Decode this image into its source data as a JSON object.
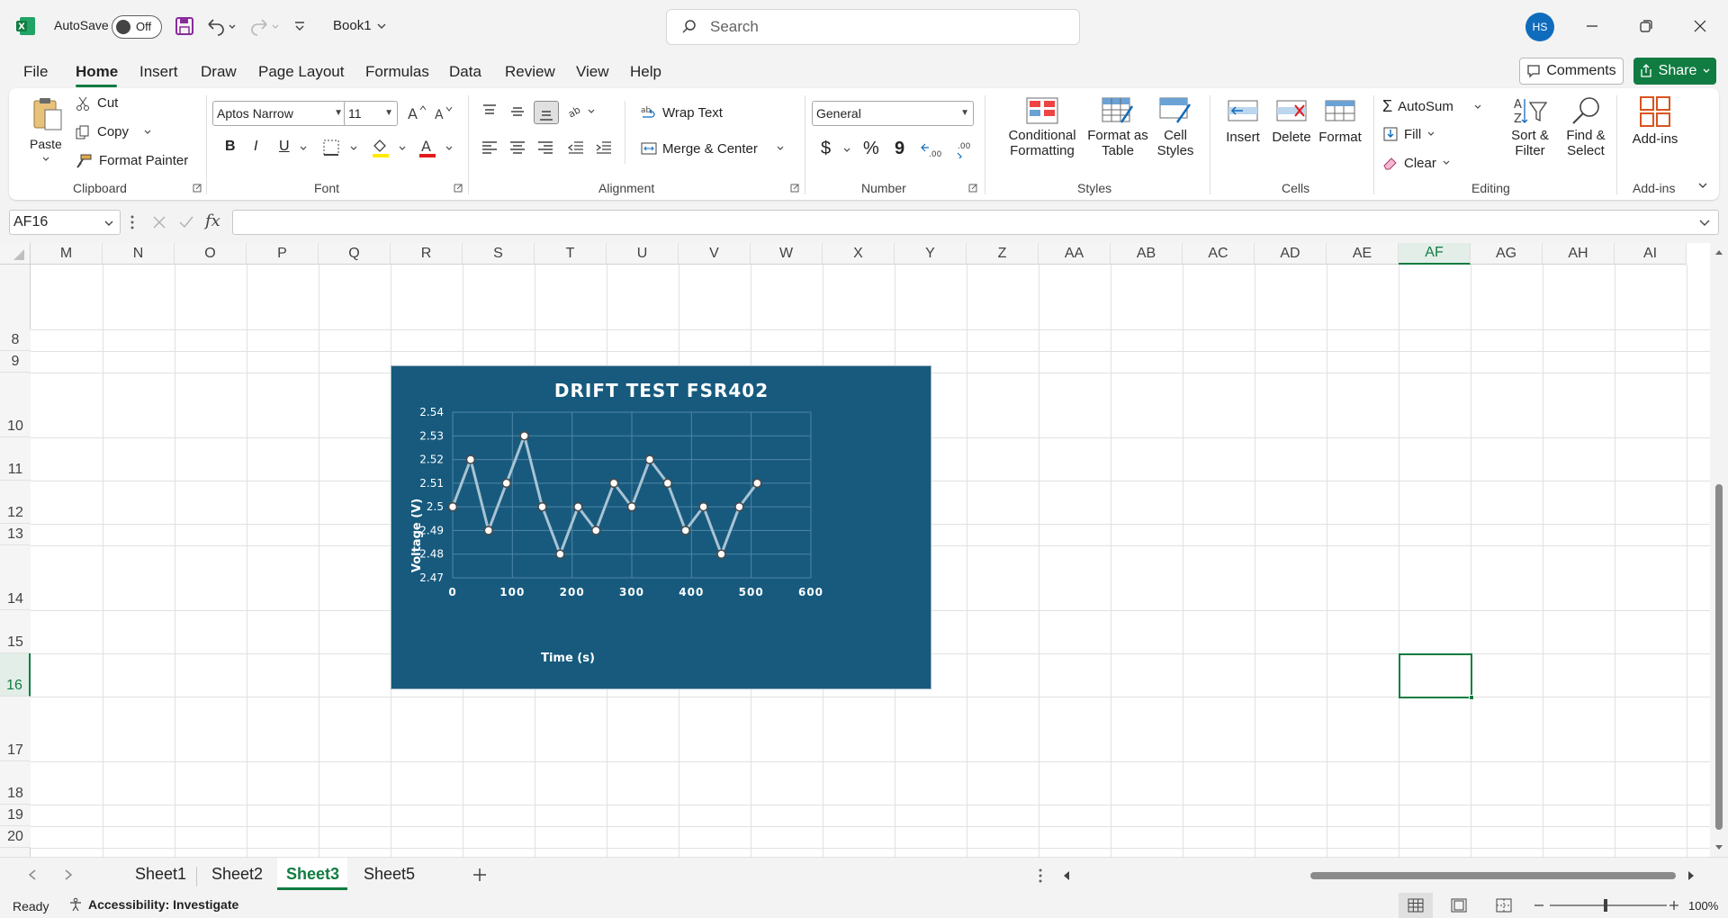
{
  "titlebar": {
    "app_icon": "excel-icon",
    "autosave_label": "AutoSave",
    "autosave_state": "Off",
    "workbook_name": "Book1",
    "search_placeholder": "Search",
    "user_initials": "HS"
  },
  "menu": {
    "items": [
      "File",
      "Home",
      "Insert",
      "Draw",
      "Page Layout",
      "Formulas",
      "Data",
      "Review",
      "View",
      "Help"
    ],
    "active": "Home",
    "comments_label": "Comments",
    "share_label": "Share"
  },
  "ribbon": {
    "clipboard": {
      "paste": "Paste",
      "cut": "Cut",
      "copy": "Copy",
      "format_painter": "Format Painter",
      "group": "Clipboard"
    },
    "font": {
      "name": "Aptos Narrow",
      "size": "11",
      "bold": "B",
      "italic": "I",
      "underline": "U",
      "group": "Font"
    },
    "alignment": {
      "wrap_text": "Wrap Text",
      "merge_center": "Merge & Center",
      "group": "Alignment"
    },
    "number": {
      "format": "General",
      "currency": "$",
      "percent": "%",
      "comma": "9",
      "group": "Number"
    },
    "styles": {
      "conditional_formatting_1": "Conditional",
      "conditional_formatting_2": "Formatting",
      "format_as_table_1": "Format as",
      "format_as_table_2": "Table",
      "cell_styles_1": "Cell",
      "cell_styles_2": "Styles",
      "group": "Styles"
    },
    "cells": {
      "insert": "Insert",
      "delete": "Delete",
      "format": "Format",
      "group": "Cells"
    },
    "editing": {
      "autosum": "AutoSum",
      "fill": "Fill",
      "clear": "Clear",
      "sort_filter_1": "Sort &",
      "sort_filter_2": "Filter",
      "find_select_1": "Find &",
      "find_select_2": "Select",
      "group": "Editing"
    },
    "addins": {
      "label": "Add-ins",
      "group": "Add-ins"
    }
  },
  "formula_bar": {
    "name_box": "AF16",
    "fx": "fx",
    "value": ""
  },
  "grid": {
    "columns": [
      "M",
      "N",
      "O",
      "P",
      "Q",
      "R",
      "S",
      "T",
      "U",
      "V",
      "W",
      "X",
      "Y",
      "Z",
      "AA",
      "AB",
      "AC",
      "AD",
      "AE",
      "AF",
      "AG",
      "AH",
      "AI"
    ],
    "selected_column": "AF",
    "rows": [
      "8",
      "9",
      "10",
      "11",
      "12",
      "13",
      "14",
      "15",
      "16",
      "17",
      "18",
      "19",
      "20"
    ],
    "selected_row": "16"
  },
  "chart_data": {
    "type": "line",
    "title": "DRIFT TEST FSR402",
    "xlabel": "Time (s)",
    "ylabel": "Voltage (V)",
    "x": [
      0,
      30,
      60,
      90,
      120,
      150,
      180,
      210,
      240,
      270,
      300,
      330,
      360,
      390,
      420,
      450,
      480,
      510
    ],
    "series": [
      {
        "values": [
          2.5,
          2.52,
          2.49,
          2.51,
          2.53,
          2.5,
          2.48,
          2.5,
          2.49,
          2.51,
          2.5,
          2.52,
          2.51,
          2.49,
          2.5,
          2.48,
          2.5,
          2.51
        ]
      }
    ],
    "xlim": [
      0,
      600
    ],
    "ylim": [
      2.47,
      2.54
    ],
    "xticks": [
      "0",
      "100",
      "200",
      "300",
      "400",
      "500",
      "600"
    ],
    "yticks": [
      "2.47",
      "2.48",
      "2.49",
      "2.5",
      "2.51",
      "2.52",
      "2.53",
      "2.54"
    ],
    "grid": true,
    "legend": "none",
    "colors": {
      "background": "#175a7e",
      "line": "#a9c4d4",
      "marker_fill": "#ffffff",
      "text": "#ffffff",
      "gridline": "#4f86a6"
    }
  },
  "sheets": {
    "tabs": [
      "Sheet1",
      "Sheet2",
      "Sheet3",
      "Sheet5"
    ],
    "active": "Sheet3"
  },
  "statusbar": {
    "ready": "Ready",
    "accessibility": "Accessibility: Investigate",
    "zoom": "100%"
  }
}
